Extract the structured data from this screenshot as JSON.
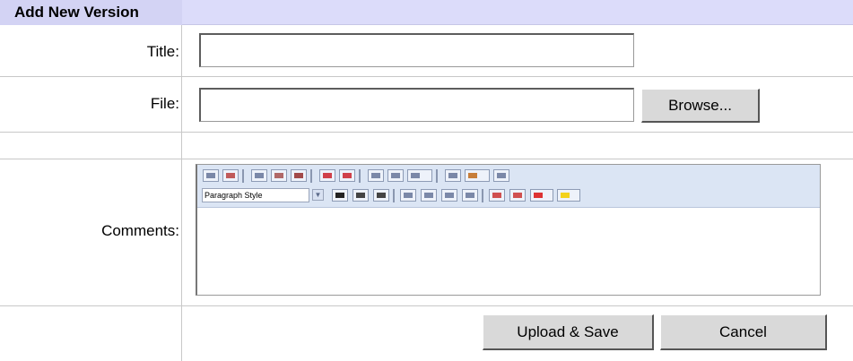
{
  "form": {
    "header_title": "Add New Version",
    "title_label": "Title:",
    "title_value": "",
    "file_label": "File:",
    "file_value": "",
    "browse_label": "Browse...",
    "comments_label": "Comments:",
    "upload_label": "Upload & Save",
    "cancel_label": "Cancel"
  },
  "editor": {
    "paragraph_style": "Paragraph Style",
    "toolbar_row1": [
      "print-icon",
      "spellcheck-icon",
      "cut-icon",
      "copy-icon",
      "paste-icon",
      "undo-icon",
      "redo-icon",
      "link-icon",
      "unlink-icon",
      "anchor-icon",
      "horizontal-rule-icon",
      "image-icon",
      "help-icon"
    ],
    "toolbar_row2": [
      "bold-icon",
      "italic-icon",
      "underline-icon",
      "align-left-icon",
      "align-center-icon",
      "align-right-icon",
      "align-justify-icon",
      "ordered-list-icon",
      "unordered-list-icon",
      "font-color-icon",
      "highlight-color-icon"
    ]
  },
  "colors": {
    "header_bg": "#dcdcfa",
    "toolbar_bg": "#dbe5f4",
    "button_bg": "#d9d9d9"
  }
}
